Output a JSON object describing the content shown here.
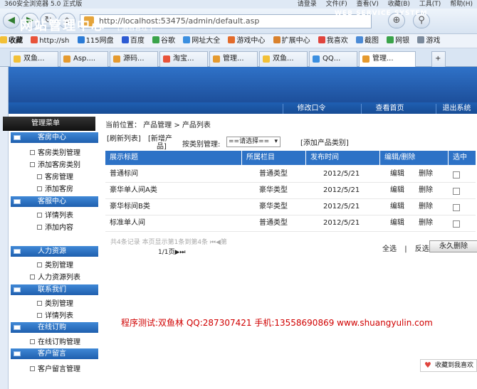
{
  "browser": {
    "title": "360安全浏览器 5.0 正式版",
    "login": "请登录",
    "menu": [
      "文件(F)",
      "查看(V)",
      "收藏(B)",
      "工具(T)",
      "帮助(H)"
    ],
    "url": "http://localhost:53475/admin/default.asp",
    "bookmarks": [
      "收藏",
      "http://sh",
      "115网盘",
      "百度",
      "谷歌",
      "网址大全",
      "游戏中心",
      "扩展中心",
      "我喜欢",
      "截图",
      "网银",
      "游戏"
    ],
    "tabs": [
      "双鱼...",
      "Asp....",
      "源码...",
      "淘宝...",
      "管理...",
      "双鱼...",
      "QQ...",
      "管理..."
    ]
  },
  "header": {
    "title": "网站管理中心",
    "subtitle": "[ 后台管理 ]",
    "tagline": "WEB SERVICE SYSTEM",
    "nav": [
      "修改口令",
      "查看首页",
      "退出系统"
    ]
  },
  "sidebar": {
    "menu_title": "管理菜单",
    "sections": [
      {
        "title": "客房中心",
        "items": [
          "客房类别管理",
          "添加客房类别",
          "客房管理",
          "添加客房"
        ]
      },
      {
        "title": "客服中心",
        "items": [
          "详情列表",
          "添加内容"
        ]
      },
      {
        "title": "人力资源",
        "items": [
          "类别管理",
          "人力资源列表"
        ]
      },
      {
        "title": "联系我们",
        "items": [
          "类别管理",
          "详情列表"
        ]
      },
      {
        "title": "在线订购",
        "items": [
          "在线订购管理"
        ]
      },
      {
        "title": "客户留言",
        "items": [
          "客户留言管理"
        ]
      }
    ]
  },
  "main": {
    "breadcrumb": "当前位置： 产品管理  >  产品列表",
    "refresh": "[刷新列表]",
    "add_line1": "[新增产",
    "add_line2": "品]",
    "filter_label": "按类别管理:",
    "filter_value": "==请选择==",
    "add_category": "[添加产品类别]",
    "columns": [
      "展示标题",
      "所属栏目",
      "发布时间",
      "编辑/删除",
      "选中"
    ],
    "rows": [
      {
        "title": "普通标间",
        "category": "普通类型",
        "date": "2012/5/21",
        "edit": "编辑",
        "del": "删除"
      },
      {
        "title": "豪华单人间A类",
        "category": "豪华类型",
        "date": "2012/5/21",
        "edit": "编辑",
        "del": "删除"
      },
      {
        "title": "豪华标间B类",
        "category": "豪华类型",
        "date": "2012/5/21",
        "edit": "编辑",
        "del": "删除"
      },
      {
        "title": "标准单人间",
        "category": "普通类型",
        "date": "2012/5/21",
        "edit": "编辑",
        "del": "删除"
      }
    ],
    "pager_line1": "共4条记录  本页显示第1条到第4条  ⏮◀第",
    "pager_line2": "1/1页▶⏭",
    "select_all": "全选",
    "separator": "|",
    "invert": "反选",
    "delete_forever": "永久删除",
    "footer": "程序测试:双鱼林 QQ:287307421 手机:13558690869 www.shuangyulin.com",
    "fav": "收藏到我喜欢"
  }
}
